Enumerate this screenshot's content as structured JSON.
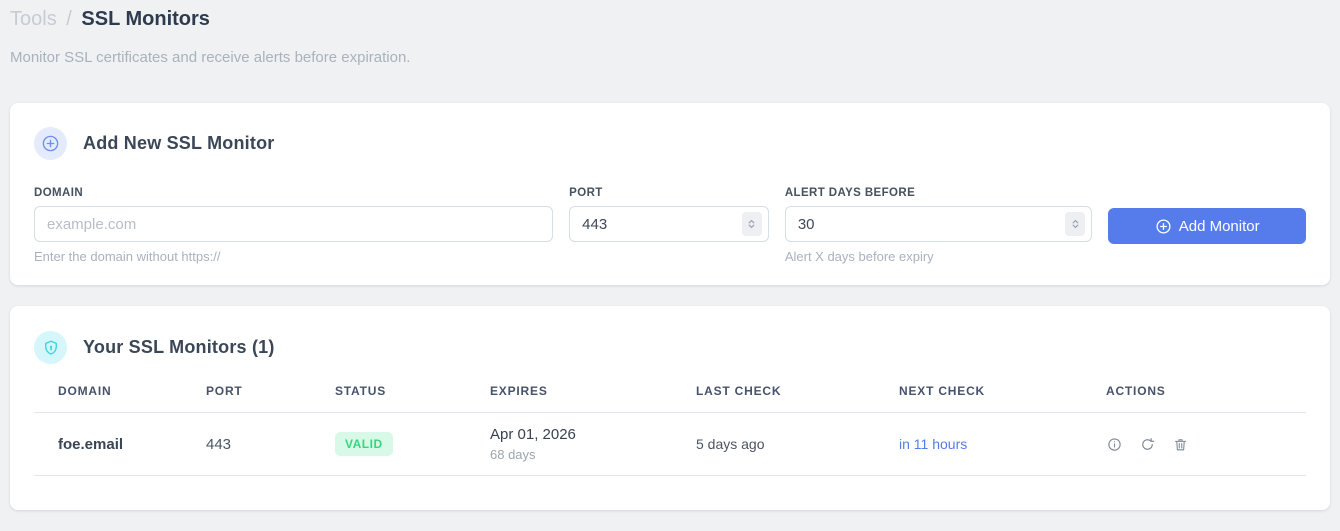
{
  "breadcrumb": {
    "section": "Tools",
    "separator": "/",
    "page": "SSL Monitors"
  },
  "subtitle": "Monitor SSL certificates and receive alerts before expiration.",
  "add_monitor_card": {
    "title": "Add New SSL Monitor",
    "fields": {
      "domain": {
        "label": "DOMAIN",
        "placeholder": "example.com",
        "hint": "Enter the domain without https://"
      },
      "port": {
        "label": "PORT",
        "value": "443"
      },
      "alert_days": {
        "label": "ALERT DAYS BEFORE",
        "value": "30",
        "hint": "Alert X days before expiry"
      }
    },
    "submit_label": "Add Monitor"
  },
  "monitors_card": {
    "title": "Your SSL Monitors (1)",
    "table": {
      "headers": [
        "DOMAIN",
        "PORT",
        "STATUS",
        "EXPIRES",
        "LAST CHECK",
        "NEXT CHECK",
        "ACTIONS"
      ],
      "rows": [
        {
          "domain": "foe.email",
          "port": "443",
          "status": "VALID",
          "expires_date": "Apr 01, 2026",
          "expires_days": "68 days",
          "last_check": "5 days ago",
          "next_check": "in 11 hours"
        }
      ]
    }
  },
  "colors": {
    "accent_blue": "#567ceb",
    "badge_green_bg": "#d9f9e8",
    "badge_green_text": "#34d77e",
    "icon_cyan": "#33d6e2",
    "page_bg": "#f0f1f3"
  }
}
